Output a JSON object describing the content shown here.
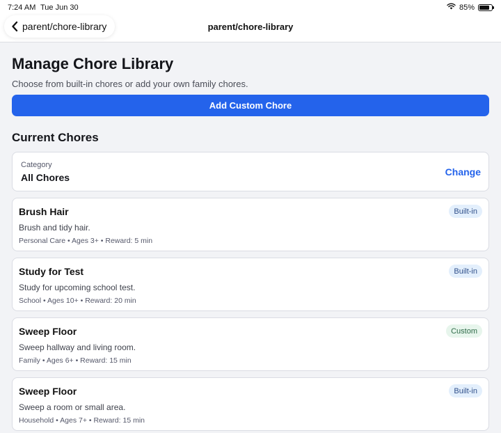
{
  "status_bar": {
    "time": "7:24 AM",
    "date": "Tue Jun 30",
    "battery": "85%",
    "battery_level": 0.85,
    "wifi_icon": "wifi-icon"
  },
  "nav": {
    "back_label": "parent/chore-library",
    "title": "parent/chore-library",
    "back_icon": "chevron-left-icon"
  },
  "page": {
    "title": "Manage Chore Library",
    "subtitle": "Choose from built-in chores or add your own family chores.",
    "add_button_label": "Add Custom Chore",
    "section_title": "Current Chores"
  },
  "category": {
    "label": "Category",
    "value": "All Chores",
    "change_label": "Change"
  },
  "chores": [
    {
      "title": "Brush Hair",
      "description": "Brush and tidy hair.",
      "meta": "Personal Care • Ages 3+ • Reward: 5 min",
      "badge": "Built-in",
      "badge_type": "builtin"
    },
    {
      "title": "Study for Test",
      "description": "Study for upcoming school test.",
      "meta": "School • Ages 10+ • Reward: 20 min",
      "badge": "Built-in",
      "badge_type": "builtin"
    },
    {
      "title": "Sweep Floor",
      "description": "Sweep hallway and living room.",
      "meta": "Family • Ages 6+ • Reward: 15 min",
      "badge": "Custom",
      "badge_type": "custom"
    },
    {
      "title": "Sweep Floor",
      "description": "Sweep a room or small area.",
      "meta": "Household • Ages 7+ • Reward: 15 min",
      "badge": "Built-in",
      "badge_type": "builtin"
    }
  ],
  "colors": {
    "accent": "#2463eb",
    "background": "#f2f3f6",
    "builtin_badge_bg": "#e3effc",
    "custom_badge_bg": "#e7f5ec"
  }
}
